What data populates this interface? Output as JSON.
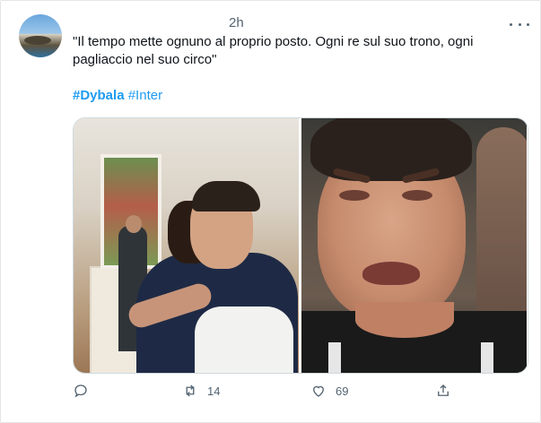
{
  "tweet": {
    "time": "2h",
    "text": "\"Il tempo mette ognuno al proprio posto. Ogni re sul suo trono, ogni pagliaccio nel suo circo\"",
    "hashtags": [
      "#Dybala",
      "#Inter"
    ]
  },
  "media": [
    {
      "alt": "photo-hug"
    },
    {
      "alt": "photo-crying"
    }
  ],
  "actions": {
    "reply_count": "",
    "retweet_count": "14",
    "like_count": "69",
    "share_count": ""
  },
  "icons": {
    "more": "more-icon",
    "reply": "reply-icon",
    "retweet": "retweet-icon",
    "like": "like-icon",
    "share": "share-icon"
  },
  "colors": {
    "link": "#1d9bf0",
    "muted": "#536471",
    "text": "#0f1419"
  }
}
